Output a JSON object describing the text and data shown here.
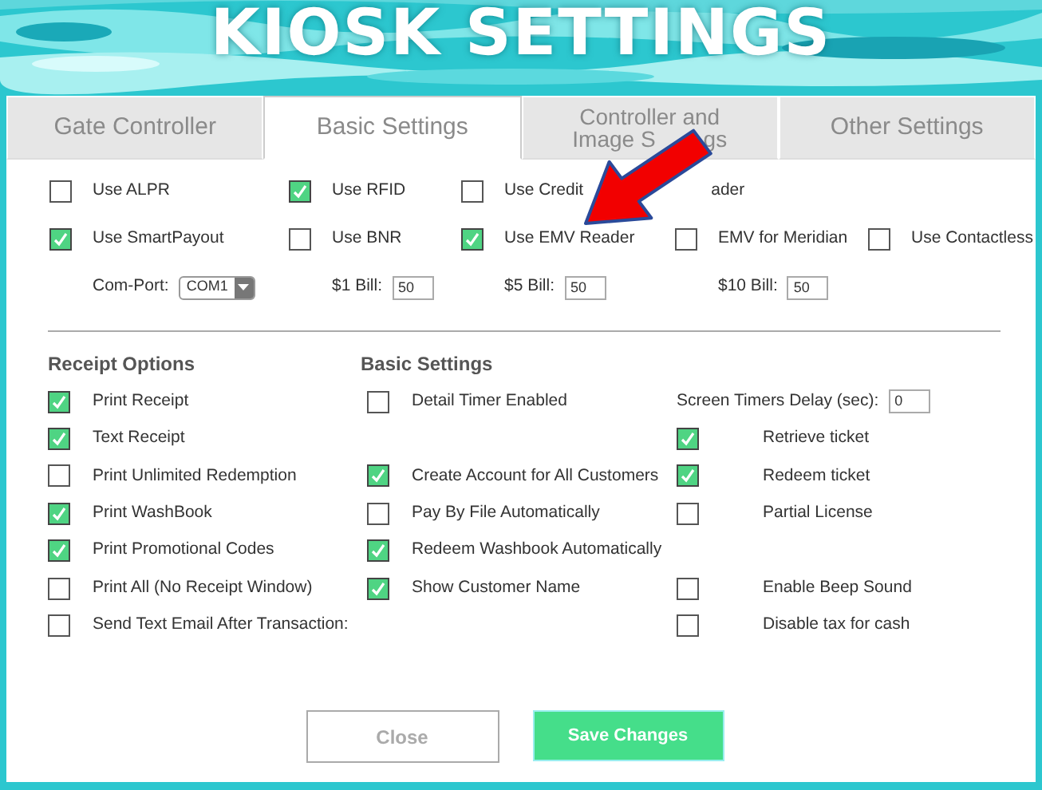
{
  "title": "KIOSK SETTINGS",
  "tabs": [
    {
      "lines": [
        "Gate Controller"
      ],
      "selected": false
    },
    {
      "lines": [
        "Basic Settings"
      ],
      "selected": true
    },
    {
      "lines": [
        "Controller and",
        "Image S",
        "gs"
      ],
      "selected": false
    },
    {
      "lines": [
        "Other Settings"
      ],
      "selected": false
    }
  ],
  "device_rows": [
    [
      {
        "kind": "checkbox",
        "label": "Use ALPR",
        "checked": false
      },
      {
        "kind": "checkbox",
        "label": "Use RFID",
        "checked": true
      },
      {
        "kind": "checkbox",
        "label": "Use Credit",
        "label_end": "ader",
        "checked": false
      }
    ],
    [
      {
        "kind": "checkbox",
        "label": "Use SmartPayout",
        "checked": true
      },
      {
        "kind": "checkbox",
        "label": "Use BNR",
        "checked": false
      },
      {
        "kind": "checkbox",
        "label": "Use EMV Reader",
        "checked": true
      },
      {
        "kind": "checkbox",
        "label": "EMV for Meridian",
        "checked": false
      },
      {
        "kind": "checkbox",
        "label": "Use Contactless",
        "checked": false
      }
    ],
    [
      {
        "kind": "select",
        "label": "Com-Port:",
        "value": "COM1"
      },
      {
        "kind": "input",
        "label": "$1 Bill:",
        "value": "50"
      },
      {
        "kind": "input",
        "label": "$5 Bill:",
        "value": "50"
      },
      {
        "kind": "input",
        "label": "$10 Bill:",
        "value": "50"
      }
    ]
  ],
  "headings": [
    "Receipt Options",
    "Basic Settings"
  ],
  "option_rows": [
    {
      "receipt": {
        "kind": "checkbox",
        "label": "Print Receipt",
        "checked": true
      },
      "basic": {
        "kind": "checkbox",
        "label": "Detail Timer Enabled",
        "checked": false
      },
      "other": {
        "kind": "input",
        "label": "Screen Timers Delay (sec):",
        "value": "0"
      }
    },
    {
      "receipt": {
        "kind": "checkbox",
        "label": "Text Receipt",
        "checked": true
      },
      "other": {
        "kind": "checkbox",
        "label": "Retrieve ticket",
        "checked": true
      }
    },
    {
      "receipt": {
        "kind": "checkbox",
        "label": "Print Unlimited Redemption",
        "checked": false
      },
      "basic": {
        "kind": "checkbox",
        "label": "Create Account for All Customers",
        "checked": true
      },
      "other": {
        "kind": "checkbox",
        "label": "Redeem ticket",
        "checked": true
      }
    },
    {
      "receipt": {
        "kind": "checkbox",
        "label": "Print WashBook",
        "checked": true
      },
      "basic": {
        "kind": "checkbox",
        "label": "Pay By File Automatically",
        "checked": false
      },
      "other": {
        "kind": "checkbox",
        "label": "Partial License",
        "checked": false
      }
    },
    {
      "receipt": {
        "kind": "checkbox",
        "label": "Print Promotional Codes",
        "checked": true
      },
      "basic": {
        "kind": "checkbox",
        "label": "Redeem Washbook Automatically",
        "checked": true
      }
    },
    {
      "receipt": {
        "kind": "checkbox",
        "label": "Print All (No Receipt Window)",
        "checked": false
      },
      "basic": {
        "kind": "checkbox",
        "label": "Show Customer Name",
        "checked": true
      },
      "other": {
        "kind": "checkbox",
        "label": "Enable Beep Sound",
        "checked": false
      }
    },
    {
      "receipt": {
        "kind": "checkbox",
        "label": "Send Text Email After Transaction:",
        "checked": false
      },
      "other": {
        "kind": "checkbox",
        "label": "Disable tax for cash",
        "checked": false
      }
    }
  ],
  "buttons": [
    {
      "label": "Close",
      "kind": "secondary"
    },
    {
      "label": "Save Changes",
      "kind": "primary"
    }
  ]
}
